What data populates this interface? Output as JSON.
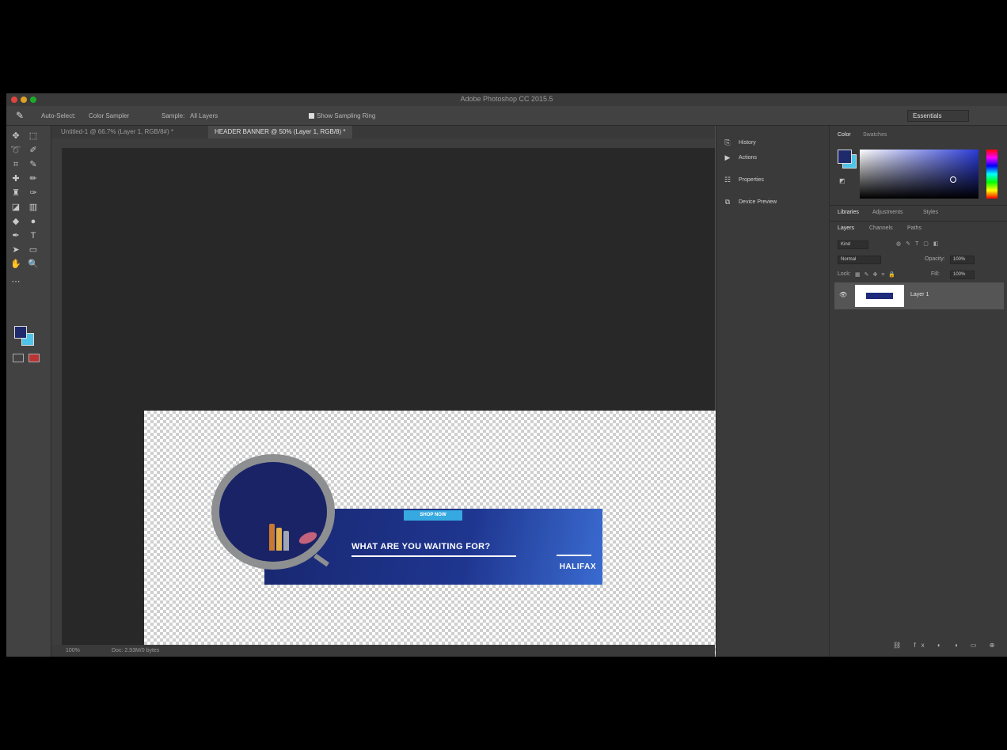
{
  "app": {
    "window_title": "Adobe Photoshop CC 2015.5"
  },
  "options_bar": {
    "auto_select_label": "Auto-Select:",
    "auto_select_value": "Color Sampler",
    "sample_label": "Sample:",
    "sample_value": "All Layers",
    "show_ring_label": "Show Sampling Ring",
    "workspace": "Essentials"
  },
  "tabs": [
    {
      "label": "Untitled-1 @ 66.7% (Layer 1, RGB/8#) *"
    },
    {
      "label": "HEADER BANNER @ 50% (Layer 1, RGB/8) *"
    }
  ],
  "canvas": {
    "banner_tag": "SHOP NOW",
    "headline": "WHAT ARE YOU WAITING FOR?",
    "logo_text": "HALIFAX"
  },
  "status": {
    "zoom": "100%",
    "doc_info": "Doc: 2.93M/0 bytes"
  },
  "mid_panel": {
    "items": [
      {
        "label": "History"
      },
      {
        "label": "Actions"
      },
      {
        "label": "Properties"
      },
      {
        "label": "Device Preview"
      }
    ]
  },
  "color_panel": {
    "tabs": [
      "Color",
      "Swatches"
    ],
    "fg_color": "#1e2a6b",
    "bg_color": "#4fc3e8"
  },
  "adjust_tabs": [
    "Libraries",
    "Adjustments",
    "Styles"
  ],
  "layers_panel": {
    "tabs": [
      "Layers",
      "Channels",
      "Paths"
    ],
    "kind_label": "Kind",
    "blend_mode": "Normal",
    "opacity_label": "Opacity:",
    "opacity_value": "100%",
    "lock_label": "Lock:",
    "fill_label": "Fill:",
    "fill_value": "100%",
    "layers": [
      {
        "name": "Layer 1"
      }
    ]
  },
  "colors": {
    "app_bg": "#535353",
    "panel": "#3a3a3a",
    "banner_navy": "#1f3690",
    "accent_blue": "#36a9e1"
  }
}
